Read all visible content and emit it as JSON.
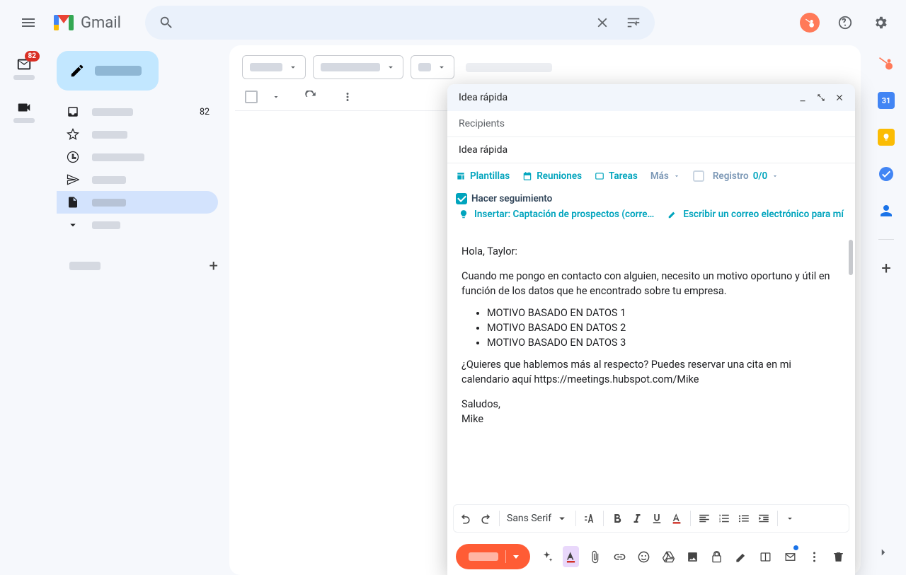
{
  "header": {
    "brand": "Gmail",
    "search_placeholder": ""
  },
  "rail": {
    "badge": "82"
  },
  "sidebar": {
    "inbox_count": "82"
  },
  "compose": {
    "title": "Idea rápida",
    "recipients_placeholder": "Recipients",
    "subject": "Idea rápida",
    "hs": {
      "templates": "Plantillas",
      "meetings": "Reuniones",
      "tasks": "Tareas",
      "more": "Más",
      "log": "Registro",
      "logcount": "0/0",
      "track": "Hacer seguimiento",
      "insert": "Insertar: Captación de prospectos (corre…",
      "writeforme": "Escribir un correo electrónico para mí"
    },
    "body": {
      "greeting": "Hola, Taylor:",
      "intro": "Cuando me pongo en contacto con alguien, necesito un motivo oportuno y útil en función de los datos que he encontrado sobre tu empresa.",
      "b1": "MOTIVO BASADO EN DATOS 1",
      "b2": "MOTIVO BASADO EN DATOS 2",
      "b3": "MOTIVO BASADO EN DATOS 3",
      "outro": "¿Quieres que hablemos más al respecto? Puedes reservar una cita en mi calendario aquí https://meetings.hubspot.com/Mike",
      "signoff": "Saludos,",
      "name": "Mike"
    },
    "format": {
      "font": "Sans Serif"
    }
  }
}
